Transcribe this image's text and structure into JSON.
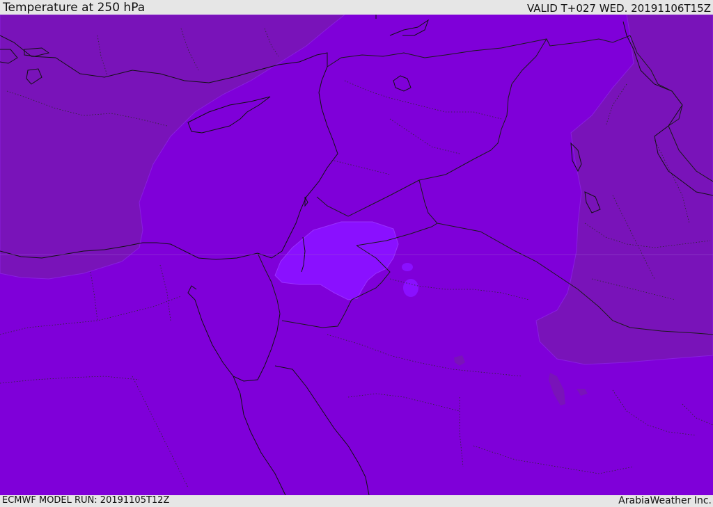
{
  "header": {
    "title": "Temperature at 250 hPa",
    "valid": "VALID T+027 WED. 20191106T15Z"
  },
  "footer": {
    "model_run": "ECMWF MODEL RUN: 20191105T12Z",
    "credit": "ArabiaWeather Inc."
  },
  "map": {
    "field": "temperature",
    "level": "250 hPa",
    "colors": {
      "base_fill": "#7f00d9",
      "warmer_fill": "#7913b9",
      "colder_fill": "#8a10ff",
      "coastline": "#111111",
      "border": "#222222"
    }
  }
}
